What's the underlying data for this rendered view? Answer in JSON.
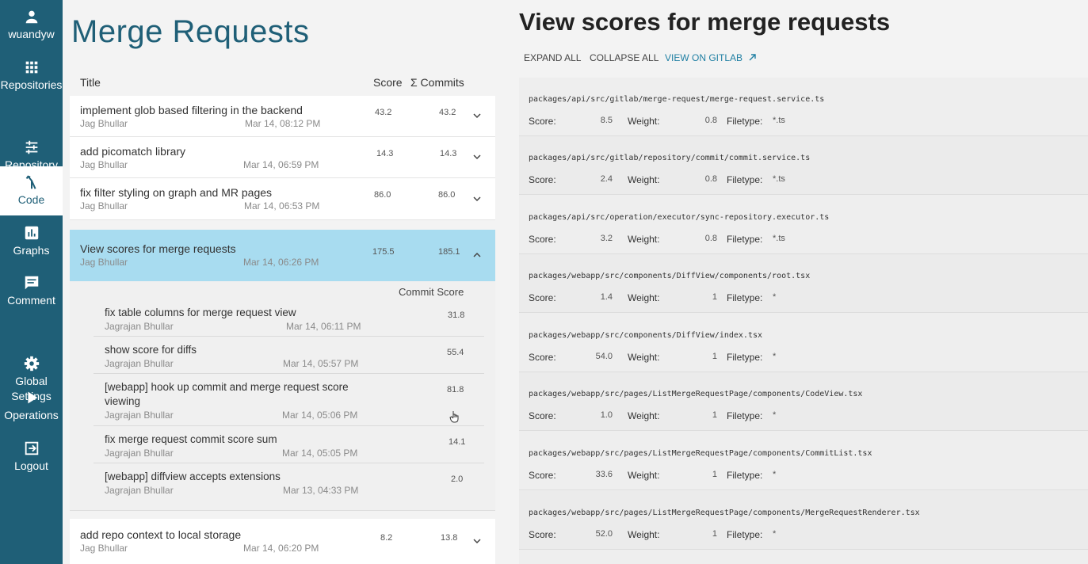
{
  "sidebar": {
    "user": "wuandyw",
    "items": [
      {
        "label": "Repositories"
      },
      {
        "label": "Repository\nSetup"
      },
      {
        "label": "Code"
      },
      {
        "label": "Graphs"
      },
      {
        "label": "Comment"
      },
      {
        "label": "Global\nSettings"
      },
      {
        "label": "Operations"
      },
      {
        "label": "Logout"
      }
    ]
  },
  "left": {
    "title": "Merge Requests",
    "columns": {
      "title": "Title",
      "score": "Score",
      "commits": "Σ Commits"
    },
    "merge_requests": [
      {
        "title": "implement glob based filtering in the backend",
        "author": "Jag Bhullar",
        "date": "Mar 14, 08:12 PM",
        "score": "43.2",
        "commits": "43.2"
      },
      {
        "title": "add picomatch library",
        "author": "Jag Bhullar",
        "date": "Mar 14, 06:59 PM",
        "score": "14.3",
        "commits": "14.3"
      },
      {
        "title": "fix filter styling on graph and MR pages",
        "author": "Jag Bhullar",
        "date": "Mar 14, 06:53 PM",
        "score": "86.0",
        "commits": "86.0"
      },
      {
        "title": "View scores for merge requests",
        "author": "Jag Bhullar",
        "date": "Mar 14, 06:26 PM",
        "score": "175.5",
        "commits": "185.1"
      },
      {
        "title": "add repo context to local storage",
        "author": "Jag Bhullar",
        "date": "Mar 14, 06:20 PM",
        "score": "8.2",
        "commits": "13.8"
      }
    ],
    "commit_score_header": "Commit Score",
    "commits": [
      {
        "title": "fix table columns for merge request view",
        "author": "Jagrajan Bhullar",
        "date": "Mar 14, 06:11 PM",
        "score": "31.8"
      },
      {
        "title": "show score for diffs",
        "author": "Jagrajan Bhullar",
        "date": "Mar 14, 05:57 PM",
        "score": "55.4"
      },
      {
        "title": "[webapp] hook up commit and merge request score viewing",
        "author": "Jagrajan Bhullar",
        "date": "Mar 14, 05:06 PM",
        "score": "81.8"
      },
      {
        "title": "fix merge request commit score sum",
        "author": "Jagrajan Bhullar",
        "date": "Mar 14, 05:05 PM",
        "score": "14.1"
      },
      {
        "title": "[webapp] diffview accepts extensions",
        "author": "Jagrajan Bhullar",
        "date": "Mar 13, 04:33 PM",
        "score": "2.0"
      }
    ]
  },
  "right": {
    "title": "View scores for merge requests",
    "actions": {
      "expand": "EXPAND ALL",
      "collapse": "COLLAPSE ALL",
      "gitlab": "VIEW ON GITLAB"
    },
    "labels": {
      "score": "Score:",
      "weight": "Weight:",
      "filetype": "Filetype:"
    },
    "files": [
      {
        "path": "packages/api/src/gitlab/merge-request/merge-request.service.ts",
        "score": "8.5",
        "weight": "0.8",
        "filetype": "*.ts"
      },
      {
        "path": "packages/api/src/gitlab/repository/commit/commit.service.ts",
        "score": "2.4",
        "weight": "0.8",
        "filetype": "*.ts"
      },
      {
        "path": "packages/api/src/operation/executor/sync-repository.executor.ts",
        "score": "3.2",
        "weight": "0.8",
        "filetype": "*.ts"
      },
      {
        "path": "packages/webapp/src/components/DiffView/components/root.tsx",
        "score": "1.4",
        "weight": "1",
        "filetype": "*"
      },
      {
        "path": "packages/webapp/src/components/DiffView/index.tsx",
        "score": "54.0",
        "weight": "1",
        "filetype": "*"
      },
      {
        "path": "packages/webapp/src/pages/ListMergeRequestPage/components/CodeView.tsx",
        "score": "1.0",
        "weight": "1",
        "filetype": "*"
      },
      {
        "path": "packages/webapp/src/pages/ListMergeRequestPage/components/CommitList.tsx",
        "score": "33.6",
        "weight": "1",
        "filetype": "*"
      },
      {
        "path": "packages/webapp/src/pages/ListMergeRequestPage/components/MergeRequestRenderer.tsx",
        "score": "52.0",
        "weight": "1",
        "filetype": "*"
      }
    ]
  }
}
